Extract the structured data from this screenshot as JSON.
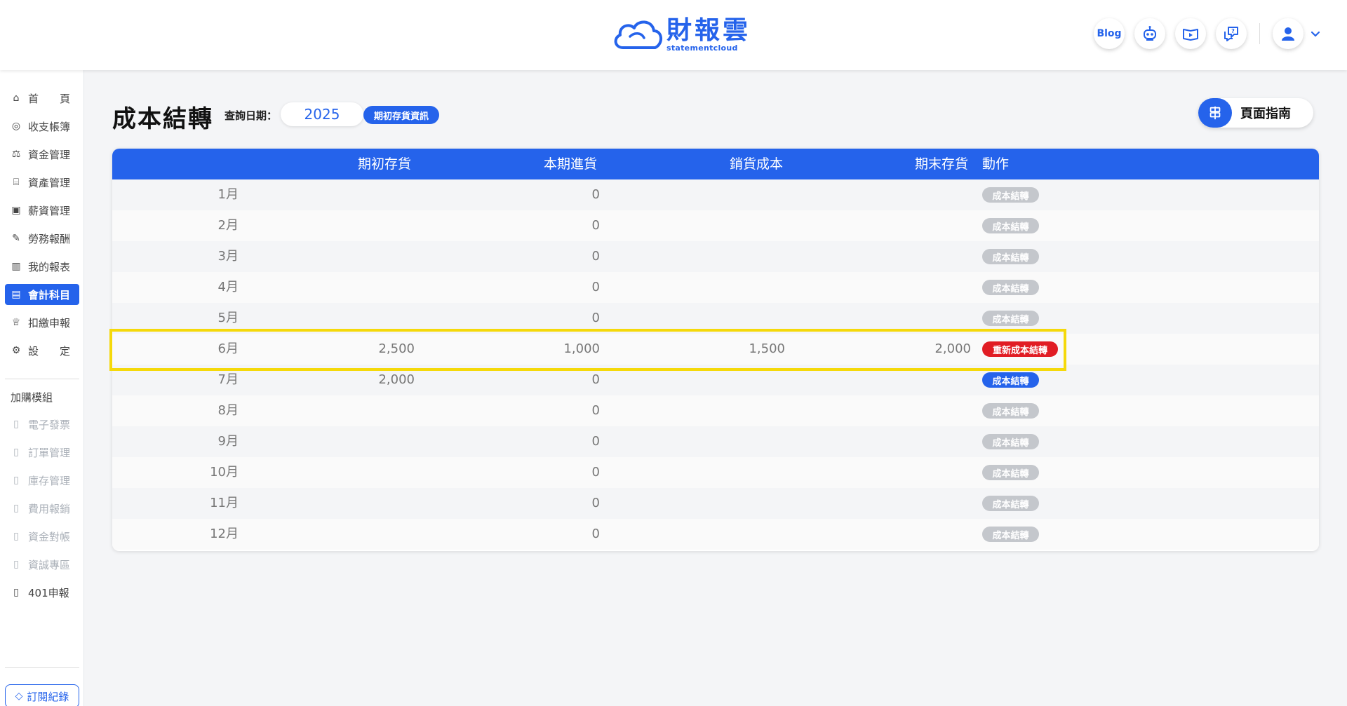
{
  "header": {
    "logo_title": "財報雲",
    "logo_subtitle": "statementcloud",
    "blog_label": "Blog",
    "icons": [
      "robot-icon",
      "video-guide-icon",
      "chat-help-icon",
      "user-avatar-icon",
      "chevron-down-icon"
    ]
  },
  "sidebar": {
    "items": [
      {
        "label": "首　　頁",
        "icon": "home-icon",
        "active": false
      },
      {
        "label": "收支帳簿",
        "icon": "coin-icon",
        "active": false
      },
      {
        "label": "資金管理",
        "icon": "fund-icon",
        "active": false
      },
      {
        "label": "資產管理",
        "icon": "bank-icon",
        "active": false
      },
      {
        "label": "薪資管理",
        "icon": "payroll-icon",
        "active": false
      },
      {
        "label": "勞務報酬",
        "icon": "labor-icon",
        "active": false
      },
      {
        "label": "我的報表",
        "icon": "chart-icon",
        "active": false
      },
      {
        "label": "會計科目",
        "icon": "ledger-icon",
        "active": true
      },
      {
        "label": "扣繳申報",
        "icon": "tax-icon",
        "active": false
      },
      {
        "label": "設　　定",
        "icon": "settings-icon",
        "active": false
      }
    ],
    "addon_section": "加購模組",
    "addons": [
      {
        "label": "電子發票",
        "enabled": false
      },
      {
        "label": "訂單管理",
        "enabled": false
      },
      {
        "label": "庫存管理",
        "enabled": false
      },
      {
        "label": "費用報銷",
        "enabled": false
      },
      {
        "label": "資金對帳",
        "enabled": false
      },
      {
        "label": "資誠專區",
        "enabled": false
      },
      {
        "label": "401申報",
        "enabled": true
      }
    ],
    "subscription_label": "訂閱紀錄"
  },
  "page": {
    "title": "成本結轉",
    "query_label": "查詢日期：",
    "year": "2025",
    "info_badge": "期初存貨資訊",
    "guide_label": "頁面指南"
  },
  "table": {
    "headers": {
      "open": "期初存貨",
      "purchase": "本期進貨",
      "cogs": "銷貨成本",
      "close": "期末存貨",
      "action": "動作"
    },
    "rows": [
      {
        "month": "1月",
        "open": "",
        "purchase": "0",
        "cogs": "",
        "close": "",
        "action": "成本結轉",
        "action_state": "disabled"
      },
      {
        "month": "2月",
        "open": "",
        "purchase": "0",
        "cogs": "",
        "close": "",
        "action": "成本結轉",
        "action_state": "disabled"
      },
      {
        "month": "3月",
        "open": "",
        "purchase": "0",
        "cogs": "",
        "close": "",
        "action": "成本結轉",
        "action_state": "disabled"
      },
      {
        "month": "4月",
        "open": "",
        "purchase": "0",
        "cogs": "",
        "close": "",
        "action": "成本結轉",
        "action_state": "disabled"
      },
      {
        "month": "5月",
        "open": "",
        "purchase": "0",
        "cogs": "",
        "close": "",
        "action": "成本結轉",
        "action_state": "disabled"
      },
      {
        "month": "6月",
        "open": "2,500",
        "purchase": "1,000",
        "cogs": "1,500",
        "close": "2,000",
        "action": "重新成本結轉",
        "action_state": "redo"
      },
      {
        "month": "7月",
        "open": "2,000",
        "purchase": "0",
        "cogs": "",
        "close": "",
        "action": "成本結轉",
        "action_state": "enabled"
      },
      {
        "month": "8月",
        "open": "",
        "purchase": "0",
        "cogs": "",
        "close": "",
        "action": "成本結轉",
        "action_state": "disabled"
      },
      {
        "month": "9月",
        "open": "",
        "purchase": "0",
        "cogs": "",
        "close": "",
        "action": "成本結轉",
        "action_state": "disabled"
      },
      {
        "month": "10月",
        "open": "",
        "purchase": "0",
        "cogs": "",
        "close": "",
        "action": "成本結轉",
        "action_state": "disabled"
      },
      {
        "month": "11月",
        "open": "",
        "purchase": "0",
        "cogs": "",
        "close": "",
        "action": "成本結轉",
        "action_state": "disabled"
      },
      {
        "month": "12月",
        "open": "",
        "purchase": "0",
        "cogs": "",
        "close": "",
        "action": "成本結轉",
        "action_state": "disabled"
      }
    ],
    "highlighted_row": "6月"
  },
  "colors": {
    "brand": "#2563eb",
    "redo": "#e11d24",
    "disabled": "#c4c7cc",
    "highlight": "#f5d90a"
  }
}
